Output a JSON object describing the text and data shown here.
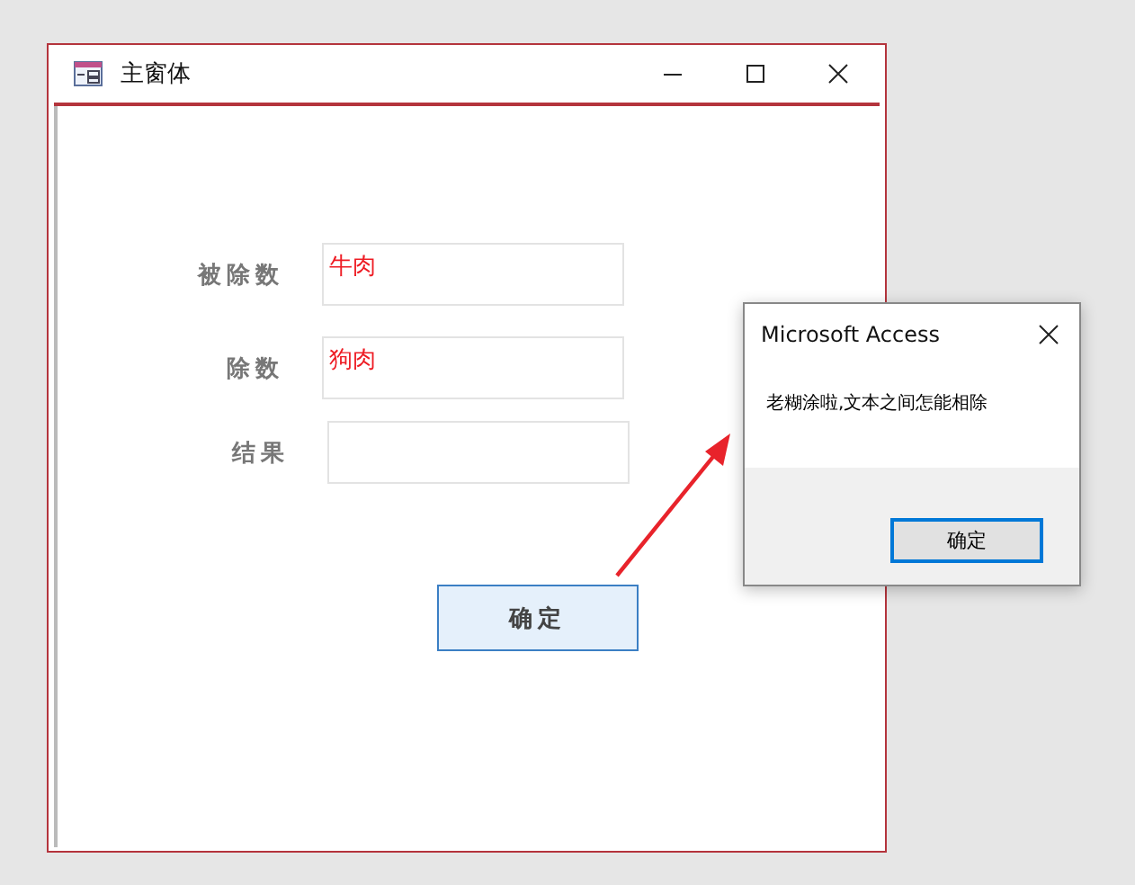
{
  "window": {
    "title": "主窗体"
  },
  "fields": [
    {
      "label": "被除数",
      "value": "牛肉"
    },
    {
      "label": "除数",
      "value": "狗肉"
    },
    {
      "label": "结果"
    }
  ],
  "submit_button": "确定",
  "dialog": {
    "title": "Microsoft Access",
    "message": "老糊涂啦,文本之间怎能相除",
    "ok_button": "确定"
  }
}
